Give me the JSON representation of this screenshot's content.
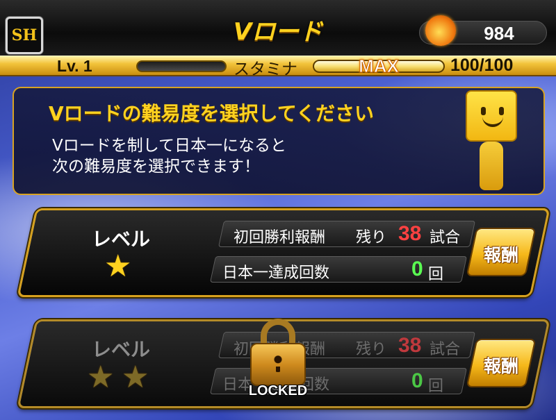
{
  "header": {
    "team_logo": "SH",
    "title": "Vロード",
    "coins": "984",
    "coin_icon": "flame-ball-icon"
  },
  "status": {
    "level": "Lv. 1",
    "stamina_label": "スタミナ",
    "stamina_max_label": "MAX",
    "stamina_value": "100/100",
    "stamina_fill": 1.0
  },
  "info": {
    "heading": "Vロードの難易度を選択してください",
    "line1": "Vロードを制して日本一になると",
    "line2": "次の難易度を選択できます！",
    "mascot_icon": "smiling-box-mascot-icon"
  },
  "levels": [
    {
      "label": "レベル",
      "stars": 1,
      "first_win_label": "初回勝利報酬",
      "remaining_label": "残り",
      "remaining_games": "38",
      "games_unit": "試合",
      "championships_label": "日本一達成回数",
      "championships": "0",
      "count_unit": "回",
      "reward_button": "報酬",
      "locked": false
    },
    {
      "label": "レベル",
      "stars": 2,
      "first_win_label": "初回勝利報酬",
      "remaining_label": "残り",
      "remaining_games": "38",
      "games_unit": "試合",
      "championships_label": "日本一達成回数",
      "championships": "0",
      "count_unit": "回",
      "reward_button": "報酬",
      "locked": true,
      "locked_label": "LOCKED"
    }
  ]
}
